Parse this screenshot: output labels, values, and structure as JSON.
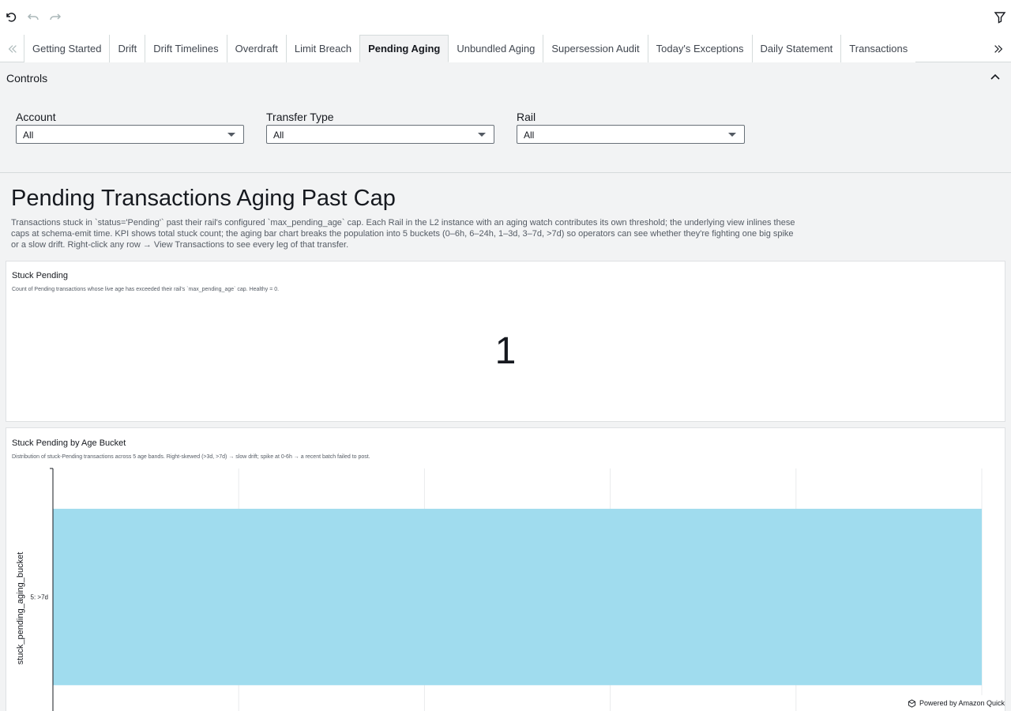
{
  "toolbar": {
    "undo_icon": "undo-icon",
    "redo_icon": "redo-icon",
    "reset_icon": "reset-icon",
    "filter_icon": "filter-icon"
  },
  "tabs": [
    {
      "label": "Getting Started"
    },
    {
      "label": "Drift"
    },
    {
      "label": "Drift Timelines"
    },
    {
      "label": "Overdraft"
    },
    {
      "label": "Limit Breach"
    },
    {
      "label": "Pending Aging"
    },
    {
      "label": "Unbundled Aging"
    },
    {
      "label": "Supersession Audit"
    },
    {
      "label": "Today's Exceptions"
    },
    {
      "label": "Daily Statement"
    },
    {
      "label": "Transactions"
    }
  ],
  "active_tab": "Pending Aging",
  "controls": {
    "title": "Controls",
    "filters": [
      {
        "label": "Account",
        "value": "All"
      },
      {
        "label": "Transfer Type",
        "value": "All"
      },
      {
        "label": "Rail",
        "value": "All"
      }
    ]
  },
  "sheet": {
    "title": "Pending Transactions Aging Past Cap",
    "description": "Transactions stuck in `status='Pending'` past their rail's configured `max_pending_age` cap. Each Rail in the L2 instance with an aging watch contributes its own threshold; the underlying view inlines these caps at schema-emit time. KPI shows total stuck count; the aging bar chart breaks the population into 5 buckets (0–6h, 6–24h, 1–3d, 3–7d, >7d) so operators can see whether they're fighting one big spike or a slow drift. Right-click any row → View Transactions to see every leg of that transfer."
  },
  "kpi_card": {
    "title": "Stuck Pending",
    "subtitle": "Count of Pending transactions whose live age has exceeded their rail's `max_pending_age` cap. Healthy = 0.",
    "value": "1"
  },
  "bar_card": {
    "title": "Stuck Pending by Age Bucket",
    "subtitle": "Distribution of stuck-Pending transactions across 5 age bands. Right-skewed (>3d, >7d) → slow drift; spike at 0-6h → a recent batch failed to post."
  },
  "chart_data": {
    "type": "bar",
    "orientation": "horizontal",
    "categories": [
      "5: >7d"
    ],
    "values": [
      1
    ],
    "title": "Stuck Pending by Age Bucket",
    "ylabel": "stuck_pending_aging_bucket",
    "xlabel": "",
    "xlim": [
      0,
      1
    ],
    "grid": true,
    "color": "#a0dcee"
  },
  "footer": {
    "powered_by": "Powered by Amazon Quick"
  }
}
